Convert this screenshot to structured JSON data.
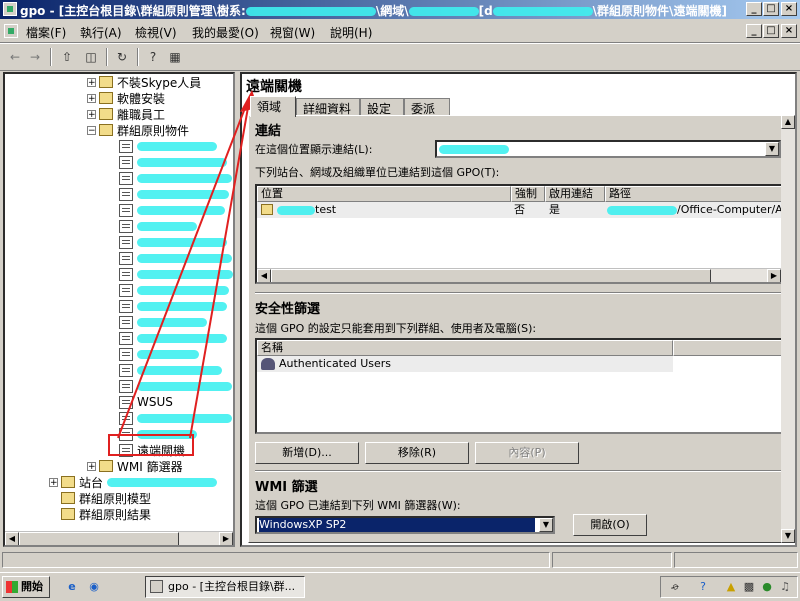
{
  "window": {
    "title_prefix": "gpo - [主控台根目錄\\群組原則管理\\樹系:",
    "title_mid": "\\網域\\",
    "title_bracket": "[d",
    "title_suffix": "\\群組原則物件\\遠端關機]",
    "minimize": "_",
    "maximize": "□",
    "close": "×"
  },
  "menu": {
    "items": [
      "檔案(F)",
      "執行(A)",
      "檢視(V)",
      "我的最愛(O)",
      "視窗(W)",
      "說明(H)"
    ],
    "mdi_min": "_",
    "mdi_max": "□",
    "mdi_close": "×"
  },
  "toolbar": {
    "icons": [
      "back-arrow-icon",
      "forward-arrow-icon",
      "up-folder-icon",
      "show-tree-icon",
      "refresh-icon",
      "help-icon",
      "properties-icon"
    ]
  },
  "tree": {
    "items": [
      {
        "label": "不裝Skype人員",
        "type": "ou"
      },
      {
        "label": "軟體安裝",
        "type": "ou"
      },
      {
        "label": "離職員工",
        "type": "ou"
      },
      {
        "label": "群組原則物件",
        "type": "folder"
      }
    ],
    "gpo_visible": [
      "WSUS",
      "遠端關機"
    ],
    "tail_items": [
      {
        "label": "WMI 篩選器"
      },
      {
        "label": "站台"
      },
      {
        "label": "群組原則模型"
      },
      {
        "label": "群組原則結果"
      }
    ]
  },
  "panel": {
    "title": "遠端關機",
    "tabs": [
      "領域",
      "詳細資料",
      "設定",
      "委派"
    ],
    "links": {
      "header": "連結",
      "location_label": "在這個位置顯示連結(L):",
      "linked_label": "下列站台、網域及組織單位已連結到這個 GPO(T):",
      "columns": [
        "位置",
        "強制",
        "啟用連結",
        "路徑"
      ],
      "rows": [
        {
          "location_suffix": "test",
          "enforced": "否",
          "enabled": "是",
          "path_suffix": "/Office-Computer/ADM"
        }
      ]
    },
    "security": {
      "header": "安全性篩選",
      "desc": "這個 GPO 的設定只能套用到下列群組、使用者及電腦(S):",
      "column": "名稱",
      "entries": [
        "Authenticated Users"
      ],
      "add_button": "新增(D)...",
      "remove_button": "移除(R)",
      "properties_button": "內容(P)"
    },
    "wmi": {
      "header": "WMI 篩選",
      "desc": "這個 GPO 已連結到下列 WMI 篩選器(W):",
      "selected": "WindowsXP SP2",
      "open_button": "開啟(O)"
    }
  },
  "taskbar": {
    "start": "開始",
    "window_button": "gpo - [主控台根目錄\\群..."
  },
  "colors": {
    "title_active": "#0a246a",
    "annotation_red": "#e02020",
    "redaction": "#3ff0f0"
  }
}
